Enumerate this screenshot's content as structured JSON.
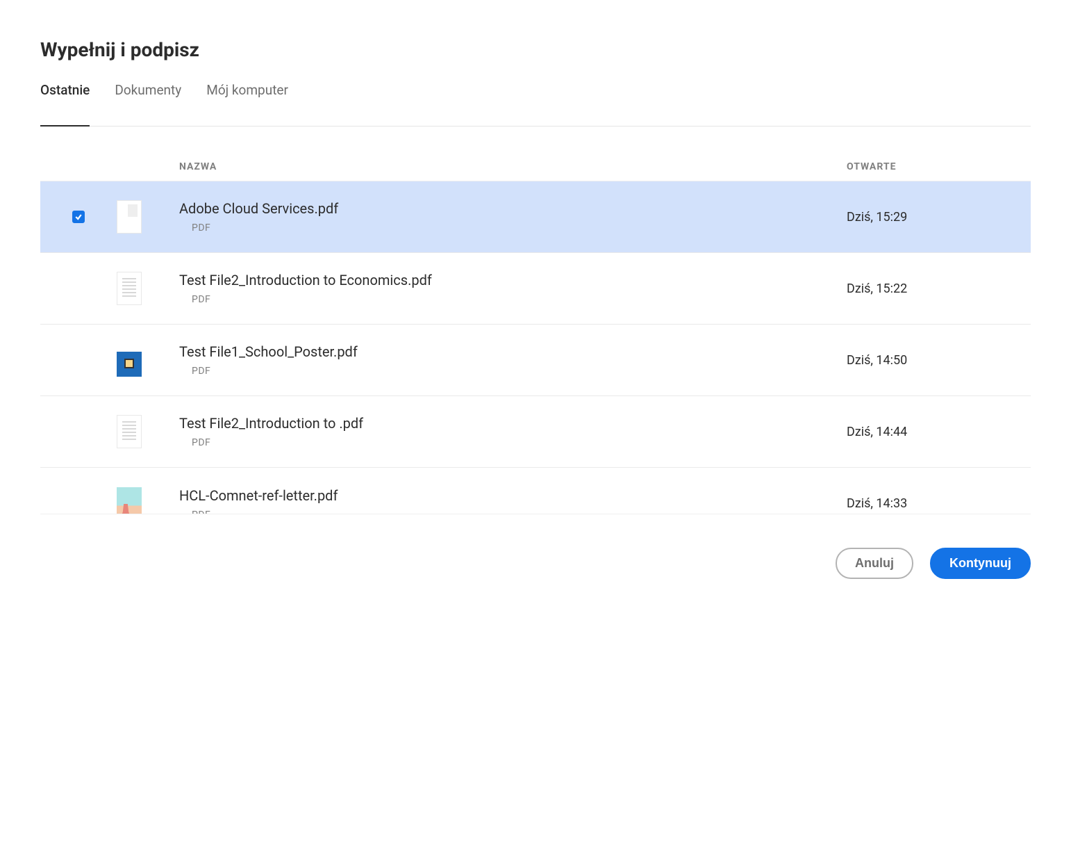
{
  "title": "Wypełnij i podpisz",
  "tabs": [
    {
      "label": "Ostatnie",
      "active": true
    },
    {
      "label": "Dokumenty",
      "active": false
    },
    {
      "label": "Mój komputer",
      "active": false
    }
  ],
  "columns": {
    "name": "NAZWA",
    "opened": "OTWARTE"
  },
  "files": [
    {
      "name": "Adobe Cloud Services.pdf",
      "type": "PDF",
      "opened": "Dziś, 15:29",
      "selected": true,
      "thumb": "blank"
    },
    {
      "name": "Test File2_Introduction to Economics.pdf",
      "type": "PDF",
      "opened": "Dziś, 15:22",
      "selected": false,
      "thumb": "lines"
    },
    {
      "name": "Test File1_School_Poster.pdf",
      "type": "PDF",
      "opened": "Dziś, 14:50",
      "selected": false,
      "thumb": "poster"
    },
    {
      "name": "Test File2_Introduction to .pdf",
      "type": "PDF",
      "opened": "Dziś, 14:44",
      "selected": false,
      "thumb": "lines"
    },
    {
      "name": "HCL-Comnet-ref-letter.pdf",
      "type": "PDF",
      "opened": "Dziś, 14:33",
      "selected": false,
      "thumb": "postcard"
    }
  ],
  "buttons": {
    "cancel": "Anuluj",
    "continue": "Kontynuuj"
  }
}
